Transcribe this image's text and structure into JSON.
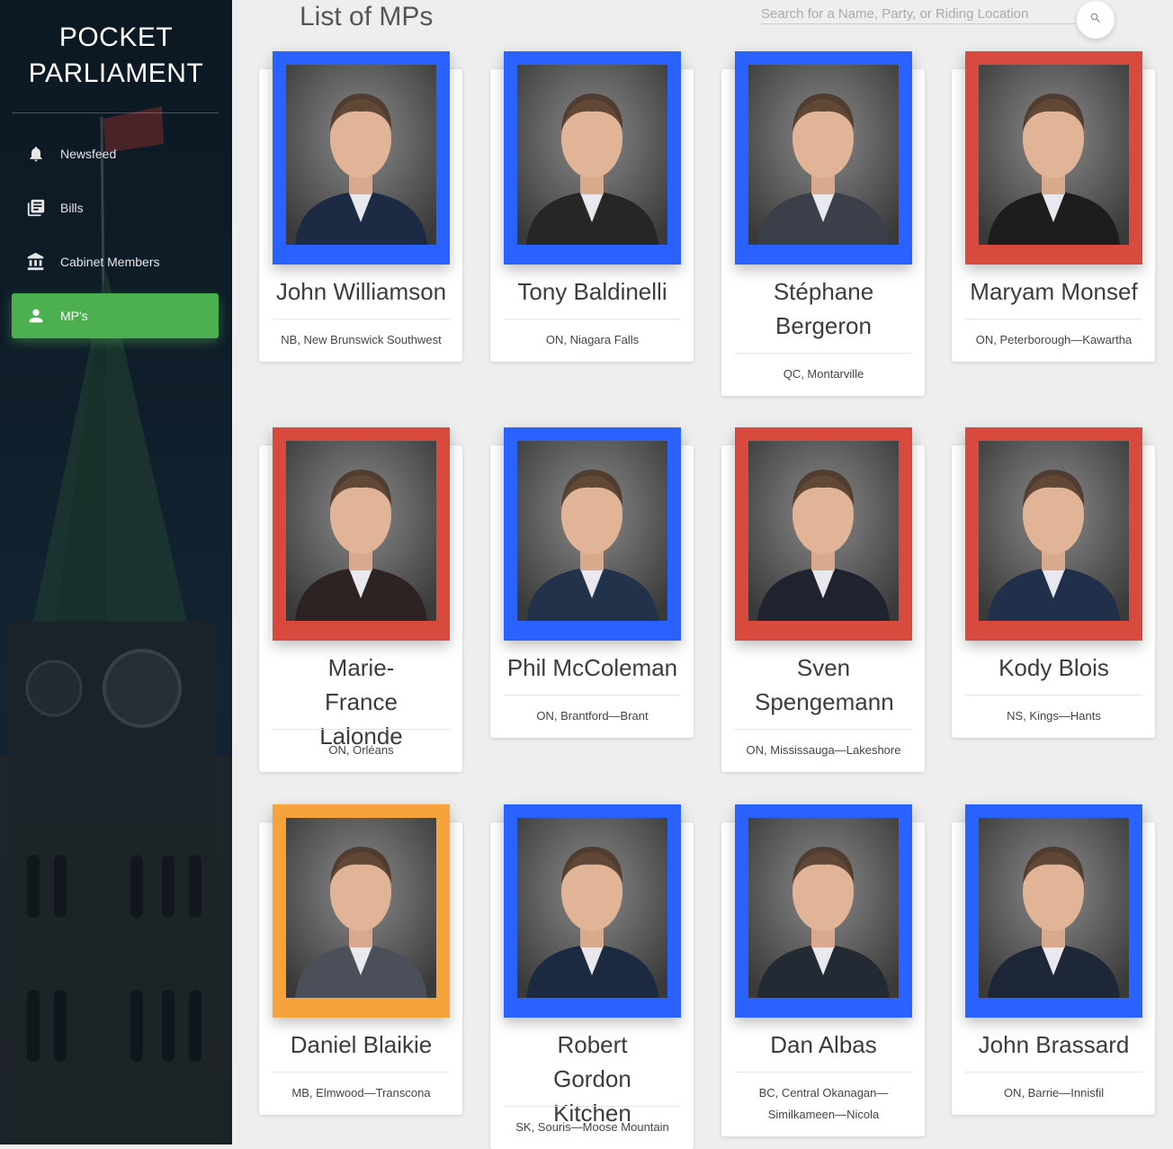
{
  "app": {
    "brand": "POCKET\nPARLIAMENT",
    "brand_line1": "POCKET",
    "brand_line2": "PARLIAMENT"
  },
  "sidebar": {
    "items": [
      {
        "label": "Newsfeed",
        "icon": "bell-icon"
      },
      {
        "label": "Bills",
        "icon": "library-books-icon"
      },
      {
        "label": "Cabinet Members",
        "icon": "account-balance-icon"
      },
      {
        "label": "MP's",
        "icon": "person-icon",
        "active": true
      }
    ],
    "active_color": "#4caf50"
  },
  "main": {
    "title": "List of MPs",
    "search": {
      "placeholder": "Search for a Name, Party, or Riding Location",
      "value": ""
    }
  },
  "party_colors": {
    "blue": "#2962ff",
    "red": "#d84a3e",
    "orange": "#f5a33a"
  },
  "mps": [
    {
      "name": "John Williamson",
      "riding": "NB, New Brunswick Southwest",
      "frame": "blue"
    },
    {
      "name": "Tony Baldinelli",
      "riding": "ON, Niagara Falls",
      "frame": "blue"
    },
    {
      "name": "Stéphane Bergeron",
      "riding": "QC, Montarville",
      "frame": "blue"
    },
    {
      "name": "Maryam Monsef",
      "riding": "ON, Peterborough—Kawartha",
      "frame": "red"
    },
    {
      "name": "Marie-France Lalonde",
      "riding": "ON, Orléans",
      "frame": "red"
    },
    {
      "name": "Phil McColeman",
      "riding": "ON, Brantford—Brant",
      "frame": "blue"
    },
    {
      "name": "Sven Spengemann",
      "riding": "ON, Mississauga—Lakeshore",
      "frame": "red"
    },
    {
      "name": "Kody Blois",
      "riding": "NS, Kings—Hants",
      "frame": "red"
    },
    {
      "name": "Daniel Blaikie",
      "riding": "MB, Elmwood—Transcona",
      "frame": "orange"
    },
    {
      "name": "Robert Gordon Kitchen",
      "riding": "SK, Souris—Moose Mountain",
      "frame": "blue"
    },
    {
      "name": "Dan Albas",
      "riding": "BC, Central Okanagan—Similkameen—Nicola",
      "frame": "blue"
    },
    {
      "name": "John Brassard",
      "riding": "ON, Barrie—Innisfil",
      "frame": "blue"
    }
  ]
}
